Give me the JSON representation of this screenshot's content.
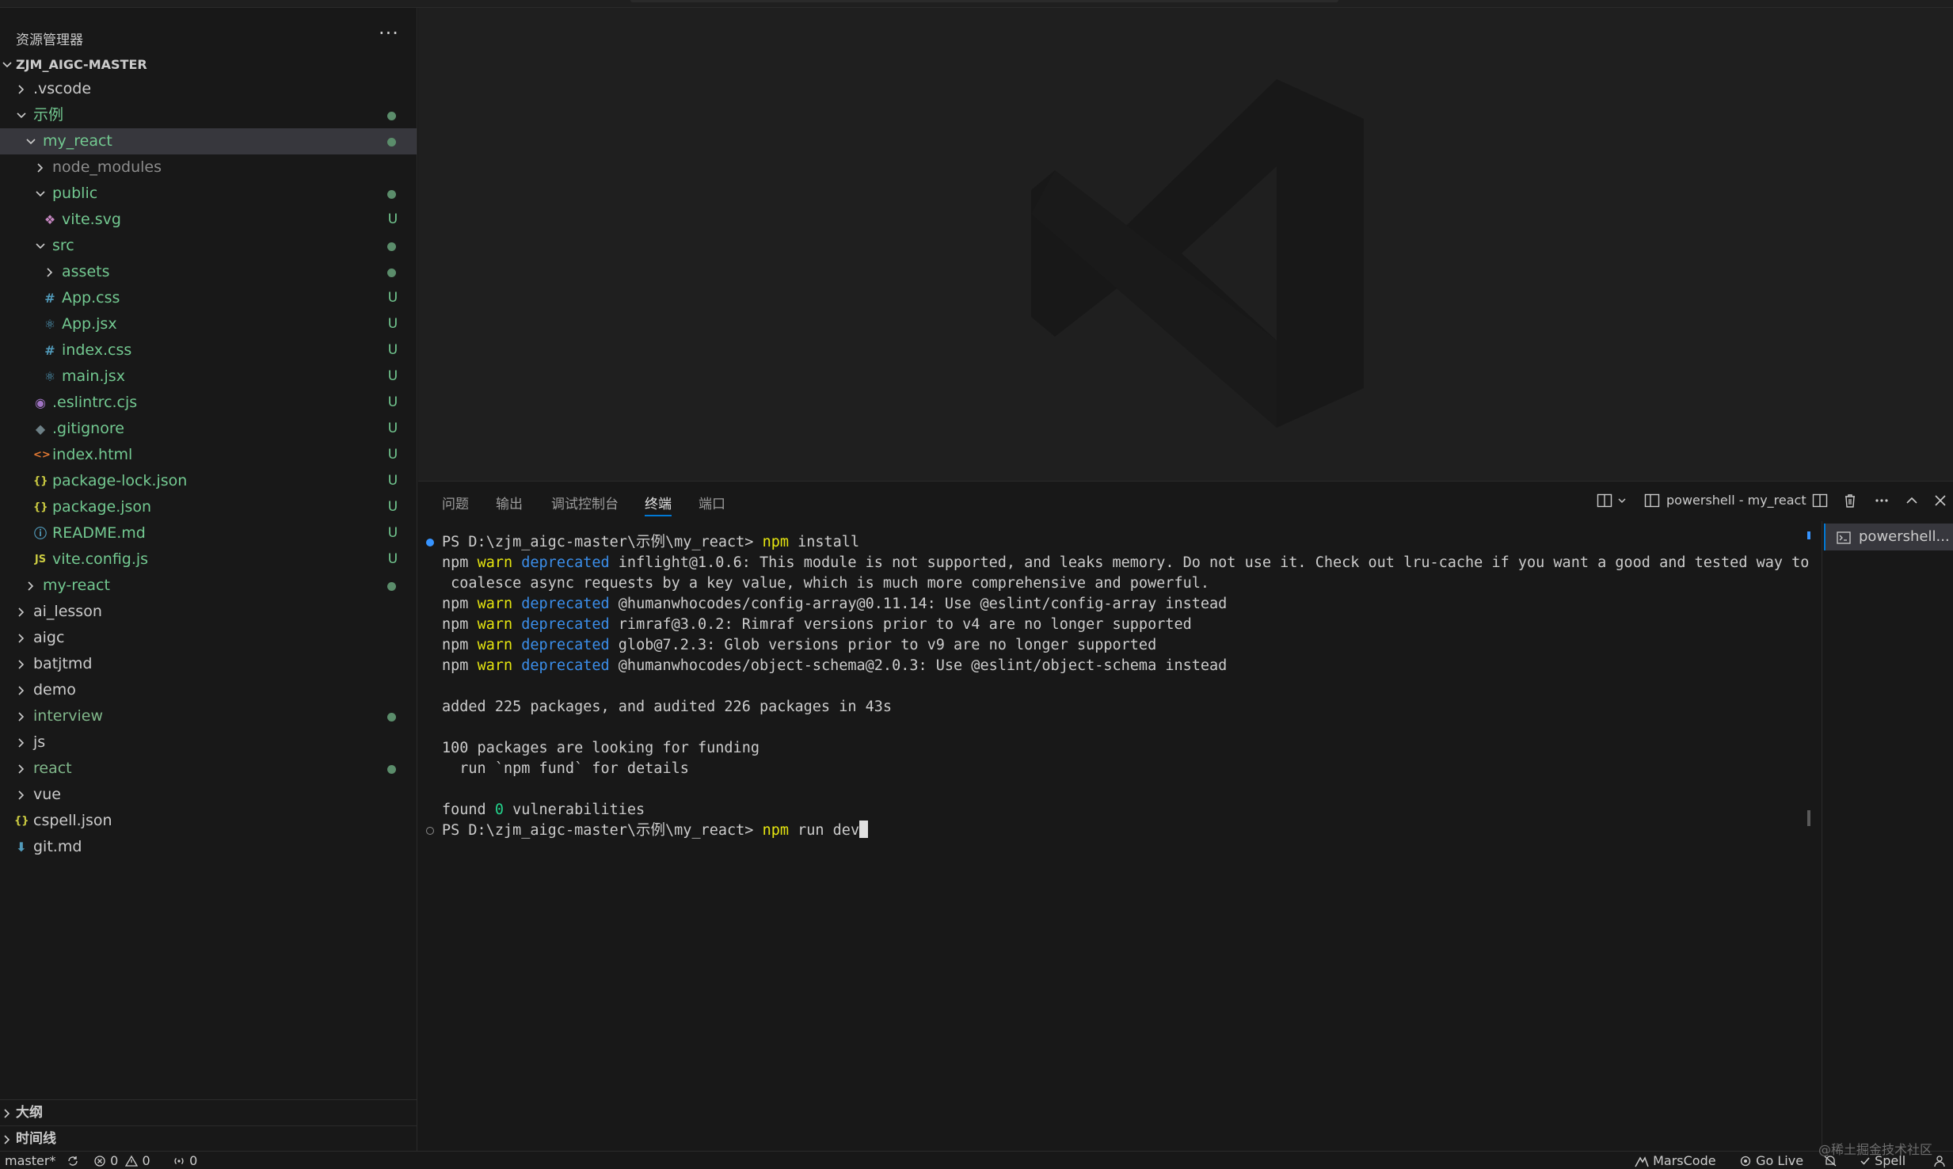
{
  "sidebar": {
    "title": "资源管理器",
    "more": "···",
    "root": "ZJM_AIGC-MASTER",
    "items": [
      {
        "label": ".vscode",
        "indent": 0,
        "kind": "folder",
        "open": false,
        "color": "white",
        "badge": ""
      },
      {
        "label": "示例",
        "indent": 0,
        "kind": "folder",
        "open": true,
        "color": "green",
        "badge": "dot"
      },
      {
        "label": "my_react",
        "indent": 1,
        "kind": "folder",
        "open": true,
        "color": "green",
        "badge": "dot",
        "selected": true
      },
      {
        "label": "node_modules",
        "indent": 2,
        "kind": "folder",
        "open": false,
        "color": "gray",
        "badge": ""
      },
      {
        "label": "public",
        "indent": 2,
        "kind": "folder",
        "open": true,
        "color": "green",
        "badge": "dot"
      },
      {
        "label": "vite.svg",
        "indent": 3,
        "kind": "svg-file",
        "color": "green",
        "badge": "U"
      },
      {
        "label": "src",
        "indent": 2,
        "kind": "folder",
        "open": true,
        "color": "green",
        "badge": "dot"
      },
      {
        "label": "assets",
        "indent": 3,
        "kind": "folder",
        "open": false,
        "color": "green",
        "badge": "dot"
      },
      {
        "label": "App.css",
        "indent": 3,
        "kind": "css-file",
        "color": "green",
        "badge": "U"
      },
      {
        "label": "App.jsx",
        "indent": 3,
        "kind": "react-file",
        "color": "green",
        "badge": "U"
      },
      {
        "label": "index.css",
        "indent": 3,
        "kind": "css-file",
        "color": "green",
        "badge": "U"
      },
      {
        "label": "main.jsx",
        "indent": 3,
        "kind": "react-file",
        "color": "green",
        "badge": "U"
      },
      {
        "label": ".eslintrc.cjs",
        "indent": 2,
        "kind": "eslint-file",
        "color": "green",
        "badge": "U"
      },
      {
        "label": ".gitignore",
        "indent": 2,
        "kind": "git-file",
        "color": "green",
        "badge": "U"
      },
      {
        "label": "index.html",
        "indent": 2,
        "kind": "html-file",
        "color": "green",
        "badge": "U"
      },
      {
        "label": "package-lock.json",
        "indent": 2,
        "kind": "json-file",
        "color": "green",
        "badge": "U"
      },
      {
        "label": "package.json",
        "indent": 2,
        "kind": "json-file",
        "color": "green",
        "badge": "U"
      },
      {
        "label": "README.md",
        "indent": 2,
        "kind": "info-file",
        "color": "green",
        "badge": "U"
      },
      {
        "label": "vite.config.js",
        "indent": 2,
        "kind": "js-file",
        "color": "green",
        "badge": "U"
      },
      {
        "label": "my-react",
        "indent": 1,
        "kind": "folder",
        "open": false,
        "color": "green",
        "badge": "dot"
      },
      {
        "label": "ai_lesson",
        "indent": 0,
        "kind": "folder",
        "open": false,
        "color": "white",
        "badge": ""
      },
      {
        "label": "aigc",
        "indent": 0,
        "kind": "folder",
        "open": false,
        "color": "white",
        "badge": ""
      },
      {
        "label": "batjtmd",
        "indent": 0,
        "kind": "folder",
        "open": false,
        "color": "white",
        "badge": ""
      },
      {
        "label": "demo",
        "indent": 0,
        "kind": "folder",
        "open": false,
        "color": "white",
        "badge": ""
      },
      {
        "label": "interview",
        "indent": 0,
        "kind": "folder",
        "open": false,
        "color": "green-dim",
        "badge": "dot"
      },
      {
        "label": "js",
        "indent": 0,
        "kind": "folder",
        "open": false,
        "color": "white",
        "badge": ""
      },
      {
        "label": "react",
        "indent": 0,
        "kind": "folder",
        "open": false,
        "color": "green-dim",
        "badge": "dot"
      },
      {
        "label": "vue",
        "indent": 0,
        "kind": "folder",
        "open": false,
        "color": "white",
        "badge": ""
      },
      {
        "label": "cspell.json",
        "indent": 0,
        "kind": "json-file",
        "color": "white",
        "badge": ""
      },
      {
        "label": "git.md",
        "indent": 0,
        "kind": "md-file",
        "color": "white",
        "badge": ""
      }
    ],
    "sections": [
      "大纲",
      "时间线"
    ]
  },
  "panel": {
    "tabs": [
      "问题",
      "输出",
      "调试控制台",
      "终端",
      "端口"
    ],
    "active_tab": "终端",
    "terminal_name": "powershell - my_react",
    "terminal_list_item": "powershell...",
    "lines": [
      {
        "deco": "blue",
        "parts": [
          {
            "t": "PS D:\\zjm_aigc-master\\示例\\my_react> ",
            "c": ""
          },
          {
            "t": "npm",
            "c": "cmd"
          },
          {
            "t": " install",
            "c": ""
          }
        ]
      },
      {
        "parts": [
          {
            "t": "npm ",
            "c": ""
          },
          {
            "t": "warn",
            "c": "warn"
          },
          {
            "t": " ",
            "c": ""
          },
          {
            "t": "deprecated",
            "c": "dep"
          },
          {
            "t": " inflight@1.0.6: This module is not supported, and leaks memory. Do not use it. Check out lru-cache if you want a good and tested way to",
            "c": ""
          }
        ]
      },
      {
        "parts": [
          {
            "t": " coalesce async requests by a key value, which is much more comprehensive and powerful.",
            "c": ""
          }
        ]
      },
      {
        "parts": [
          {
            "t": "npm ",
            "c": ""
          },
          {
            "t": "warn",
            "c": "warn"
          },
          {
            "t": " ",
            "c": ""
          },
          {
            "t": "deprecated",
            "c": "dep"
          },
          {
            "t": " @humanwhocodes/config-array@0.11.14: Use @eslint/config-array instead",
            "c": ""
          }
        ]
      },
      {
        "parts": [
          {
            "t": "npm ",
            "c": ""
          },
          {
            "t": "warn",
            "c": "warn"
          },
          {
            "t": " ",
            "c": ""
          },
          {
            "t": "deprecated",
            "c": "dep"
          },
          {
            "t": " rimraf@3.0.2: Rimraf versions prior to v4 are no longer supported",
            "c": ""
          }
        ]
      },
      {
        "parts": [
          {
            "t": "npm ",
            "c": ""
          },
          {
            "t": "warn",
            "c": "warn"
          },
          {
            "t": " ",
            "c": ""
          },
          {
            "t": "deprecated",
            "c": "dep"
          },
          {
            "t": " glob@7.2.3: Glob versions prior to v9 are no longer supported",
            "c": ""
          }
        ]
      },
      {
        "parts": [
          {
            "t": "npm ",
            "c": ""
          },
          {
            "t": "warn",
            "c": "warn"
          },
          {
            "t": " ",
            "c": ""
          },
          {
            "t": "deprecated",
            "c": "dep"
          },
          {
            "t": " @humanwhocodes/object-schema@2.0.3: Use @eslint/object-schema instead",
            "c": ""
          }
        ]
      },
      {
        "parts": []
      },
      {
        "parts": [
          {
            "t": "added 225 packages, and audited 226 packages in 43s",
            "c": ""
          }
        ]
      },
      {
        "parts": []
      },
      {
        "parts": [
          {
            "t": "100 packages are looking for funding",
            "c": ""
          }
        ]
      },
      {
        "parts": [
          {
            "t": "  run `npm fund` for details",
            "c": ""
          }
        ]
      },
      {
        "parts": []
      },
      {
        "parts": [
          {
            "t": "found ",
            "c": ""
          },
          {
            "t": "0",
            "c": "num"
          },
          {
            "t": " vulnerabilities",
            "c": ""
          }
        ]
      },
      {
        "deco": "hollow",
        "cursor": true,
        "parts": [
          {
            "t": "PS D:\\zjm_aigc-master\\示例\\my_react> ",
            "c": ""
          },
          {
            "t": "npm",
            "c": "cmd"
          },
          {
            "t": " run dev",
            "c": ""
          }
        ]
      }
    ]
  },
  "statusbar": {
    "branch": "master*",
    "errors": "0",
    "warnings": "0",
    "ports": "0",
    "marscode": "MarsCode",
    "golive": "Go Live",
    "spell": "Spell"
  },
  "watermark": "@稀土掘金技术社区",
  "colors": {
    "accent": "#0078d4",
    "untracked": "#73c991",
    "terminal_yellow": "#e5e510",
    "terminal_blue": "#3b8eea",
    "terminal_green": "#23d18b"
  }
}
